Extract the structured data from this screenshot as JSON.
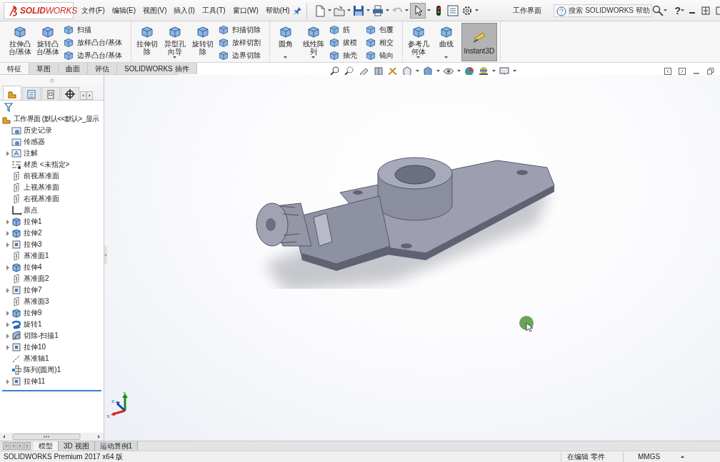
{
  "logo": "**SOLID**WORKS",
  "menu": [
    "文件(F)",
    "编辑(E)",
    "视图(V)",
    "插入(I)",
    "工具(T)",
    "窗口(W)",
    "帮助(H)"
  ],
  "document_title": "工作界面",
  "search": {
    "placeholder": "搜索 SOLIDWORKS 帮助"
  },
  "help": "?",
  "ribbon": [
    {
      "items": [
        {
          "kind": "large",
          "label": "拉伸凸台/基体",
          "dropdown": false,
          "on": false
        },
        {
          "kind": "large",
          "label": "旋转凸台/基体",
          "dropdown": false,
          "on": false
        },
        {
          "kind": "stack",
          "items": [
            "扫描",
            "放样凸台/基体",
            "边界凸台/基体"
          ]
        }
      ]
    },
    {
      "items": [
        {
          "kind": "large",
          "label": "拉伸切除",
          "dropdown": false,
          "on": false
        },
        {
          "kind": "large",
          "label": "异型孔向导",
          "dropdown": true,
          "on": false
        },
        {
          "kind": "large",
          "label": "旋转切除",
          "dropdown": false,
          "on": false
        },
        {
          "kind": "stack",
          "items": [
            "扫描切除",
            "放样切割",
            "边界切除"
          ]
        }
      ]
    },
    {
      "items": [
        {
          "kind": "large",
          "label": "圆角",
          "dropdown": true,
          "on": false
        },
        {
          "kind": "large",
          "label": "线性阵列",
          "dropdown": true,
          "on": false
        },
        {
          "kind": "stack",
          "items": [
            "筋",
            "拔模",
            "抽壳"
          ]
        },
        {
          "kind": "stack",
          "items": [
            "包覆",
            "相交",
            "镜向"
          ]
        }
      ]
    },
    {
      "items": [
        {
          "kind": "large",
          "label": "参考几何体",
          "dropdown": true,
          "on": false
        },
        {
          "kind": "large",
          "label": "曲线",
          "dropdown": true,
          "on": false
        },
        {
          "kind": "large",
          "label": "Instant3D",
          "dropdown": false,
          "on": true
        }
      ]
    }
  ],
  "command_tabs": [
    {
      "label": "特征",
      "selected": true
    },
    {
      "label": "草图",
      "selected": false
    },
    {
      "label": "曲面",
      "selected": false
    },
    {
      "label": "评估",
      "selected": false
    },
    {
      "label": "SOLIDWORKS 插件",
      "selected": false
    }
  ],
  "panel_tabs": [
    {
      "selected": true
    },
    {
      "selected": false
    },
    {
      "selected": false
    },
    {
      "selected": false
    }
  ],
  "feature_tree": {
    "label": "工作界面  (默认<<默认>_显示",
    "children": [
      {
        "label": "历史记录",
        "kind": "folder",
        "expander": false
      },
      {
        "label": "传感器",
        "kind": "folder",
        "expander": false
      },
      {
        "label": "注解",
        "kind": "annotation",
        "expander": true
      },
      {
        "label": "材质 <未指定>",
        "kind": "material",
        "expander": false
      },
      {
        "label": "前视基准面",
        "kind": "plane",
        "expander": false
      },
      {
        "label": "上视基准面",
        "kind": "plane",
        "expander": false
      },
      {
        "label": "右视基准面",
        "kind": "plane",
        "expander": false
      },
      {
        "label": "原点",
        "kind": "origin",
        "expander": false
      },
      {
        "label": "拉伸1",
        "kind": "boss",
        "expander": true
      },
      {
        "label": "拉伸2",
        "kind": "boss",
        "expander": true
      },
      {
        "label": "拉伸3",
        "kind": "cut",
        "expander": true
      },
      {
        "label": "基准面1",
        "kind": "plane",
        "expander": false
      },
      {
        "label": "拉伸4",
        "kind": "boss",
        "expander": true
      },
      {
        "label": "基准面2",
        "kind": "plane",
        "expander": false
      },
      {
        "label": "拉伸7",
        "kind": "cut",
        "expander": true
      },
      {
        "label": "基准面3",
        "kind": "plane",
        "expander": false
      },
      {
        "label": "拉伸9",
        "kind": "boss",
        "expander": true
      },
      {
        "label": "旋转1",
        "kind": "revolve",
        "expander": true
      },
      {
        "label": "切除-扫描1",
        "kind": "sweep",
        "expander": true
      },
      {
        "label": "拉伸10",
        "kind": "cut",
        "expander": true
      },
      {
        "label": "基准轴1",
        "kind": "axis",
        "expander": false
      },
      {
        "label": "阵列(圆周)1",
        "kind": "pattern",
        "expander": false
      },
      {
        "label": "拉伸11",
        "kind": "cut",
        "expander": true
      }
    ]
  },
  "triad": {
    "x": "X",
    "y": "Y",
    "z": "Z"
  },
  "view_tabs": [
    {
      "label": "模型",
      "selected": true
    },
    {
      "label": "3D 视图",
      "selected": false
    },
    {
      "label": "运动算例1",
      "selected": false
    }
  ],
  "status_bar": {
    "product": "SOLIDWORKS Premium 2017 x64 版",
    "mode": "在编辑 零件",
    "units": "MMGS"
  }
}
